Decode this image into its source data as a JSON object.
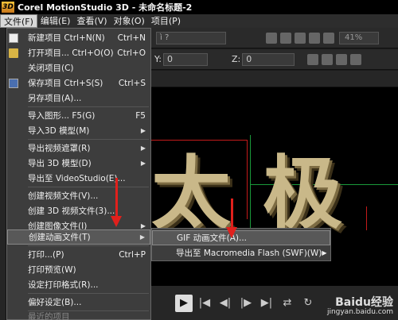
{
  "window": {
    "logo": "3D",
    "title": "Corel MotionStudio 3D - 未命名标题-2"
  },
  "menubar": [
    {
      "label": "文件(F)",
      "active": true
    },
    {
      "label": "编辑(E)"
    },
    {
      "label": "查看(V)"
    },
    {
      "label": "对象(O)"
    },
    {
      "label": "项目(P)"
    }
  ],
  "toolbar": {
    "dropdown_value": "ì ?",
    "zoom_percent": "41%",
    "y_label": "Y:",
    "y_value": "0",
    "z_label": "Z:",
    "z_value": "0"
  },
  "file_menu": {
    "items": [
      {
        "label": "新建项目 Ctrl+N(N)",
        "shortcut": "Ctrl+N",
        "icon": "new-file-icon"
      },
      {
        "label": "打开项目... Ctrl+O(O)",
        "shortcut": "Ctrl+O",
        "icon": "open-folder-icon"
      },
      {
        "label": "关闭项目(C)",
        "shortcut": ""
      },
      {
        "label": "保存项目 Ctrl+S(S)",
        "shortcut": "Ctrl+S",
        "icon": "save-icon"
      },
      {
        "label": "另存项目(A)...",
        "shortcut": ""
      },
      {
        "label": "导入图形... F5(G)",
        "shortcut": "F5"
      },
      {
        "label": "导入3D 模型(M)",
        "submenu": true
      },
      {
        "label": "导出视频遮罩(R)",
        "submenu": true
      },
      {
        "label": "导出 3D 模型(D)",
        "submenu": true
      },
      {
        "label": "导出至 VideoStudio(E)...",
        "shortcut": ""
      },
      {
        "label": "创建视频文件(V)...",
        "shortcut": ""
      },
      {
        "label": "创建 3D 视频文件(3)...",
        "shortcut": ""
      },
      {
        "label": "创建图像文件(I)",
        "submenu": true
      },
      {
        "label": "创建动画文件(T)",
        "submenu": true,
        "highlight": true
      },
      {
        "label": "打印...(P)",
        "shortcut": "Ctrl+P"
      },
      {
        "label": "打印预览(W)",
        "shortcut": ""
      },
      {
        "label": "设定打印格式(R)...",
        "shortcut": ""
      },
      {
        "label": "偏好设定(B)...",
        "shortcut": ""
      },
      {
        "label": "最近的项目",
        "disabled": true
      }
    ]
  },
  "submenu": {
    "items": [
      {
        "label": "GIF 动画文件(A)...",
        "highlight": true
      },
      {
        "label": "导出至 Macromedia Flash (SWF)(W)",
        "submenu": true
      }
    ]
  },
  "canvas": {
    "char1": "太",
    "char2": "极"
  },
  "watermark": {
    "logo": "Baidu经验",
    "url": "jingyan.baidu.com"
  },
  "colors": {
    "annotation_arrow": "#e0201c",
    "menu_bg": "#3d3d3d",
    "highlight_bg": "#585858",
    "text_3d": "#c9b889"
  }
}
